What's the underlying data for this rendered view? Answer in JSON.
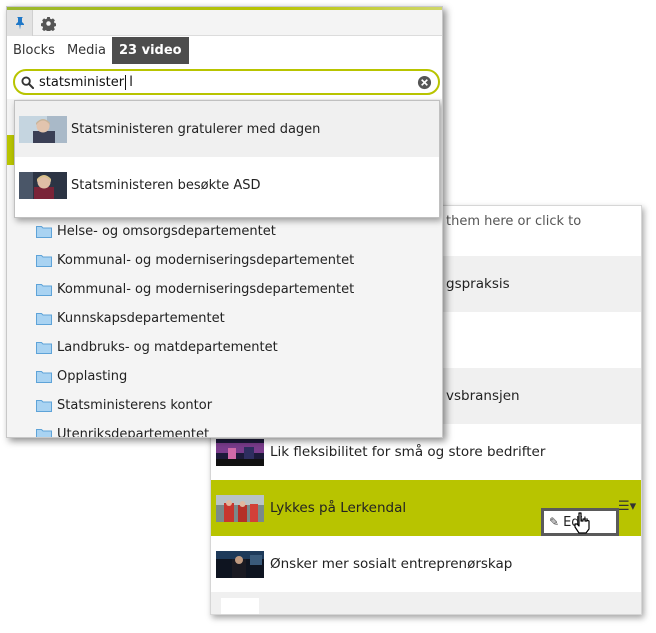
{
  "toolbar": {
    "pin": "pin-icon",
    "settings": "gear-icon"
  },
  "tabs": [
    {
      "label": "Blocks",
      "active": false
    },
    {
      "label": "Media",
      "active": false
    },
    {
      "label": "23 video",
      "active": true
    }
  ],
  "search": {
    "value": "statsminister",
    "clear_icon": "clear-icon",
    "search_icon": "search-icon"
  },
  "results": [
    {
      "label": "Statsministeren gratulerer med dagen"
    },
    {
      "label": "Statsministeren besøkte ASD"
    }
  ],
  "folders": [
    {
      "label": "Helse- og omsorgsdepartementet"
    },
    {
      "label": "Kommunal- og moderniseringsdepartementet"
    },
    {
      "label": "Kommunal- og moderniseringsdepartementet"
    },
    {
      "label": "Kunnskapsdepartementet"
    },
    {
      "label": "Landbruks- og matdepartementet"
    },
    {
      "label": "Opplasting"
    },
    {
      "label": "Statsministerens kontor"
    },
    {
      "label": "Utenriksdepartementet"
    }
  ],
  "content_area": {
    "drop_hint": "them here or click to",
    "items": [
      {
        "label": "gspraksis"
      },
      {
        "label": ""
      },
      {
        "label": "vsbransjen"
      },
      {
        "label": "Lik fleksibilitet for små og store bedrifter"
      },
      {
        "label": "Lykkes på Lerkendal",
        "selected": true
      },
      {
        "label": "Ønsker mer sosialt entreprenørskap"
      }
    ],
    "context_menu": {
      "edit_label": "Edit"
    }
  },
  "colors": {
    "accent": "#b8c400",
    "active_tab": "#4d4d4d"
  }
}
